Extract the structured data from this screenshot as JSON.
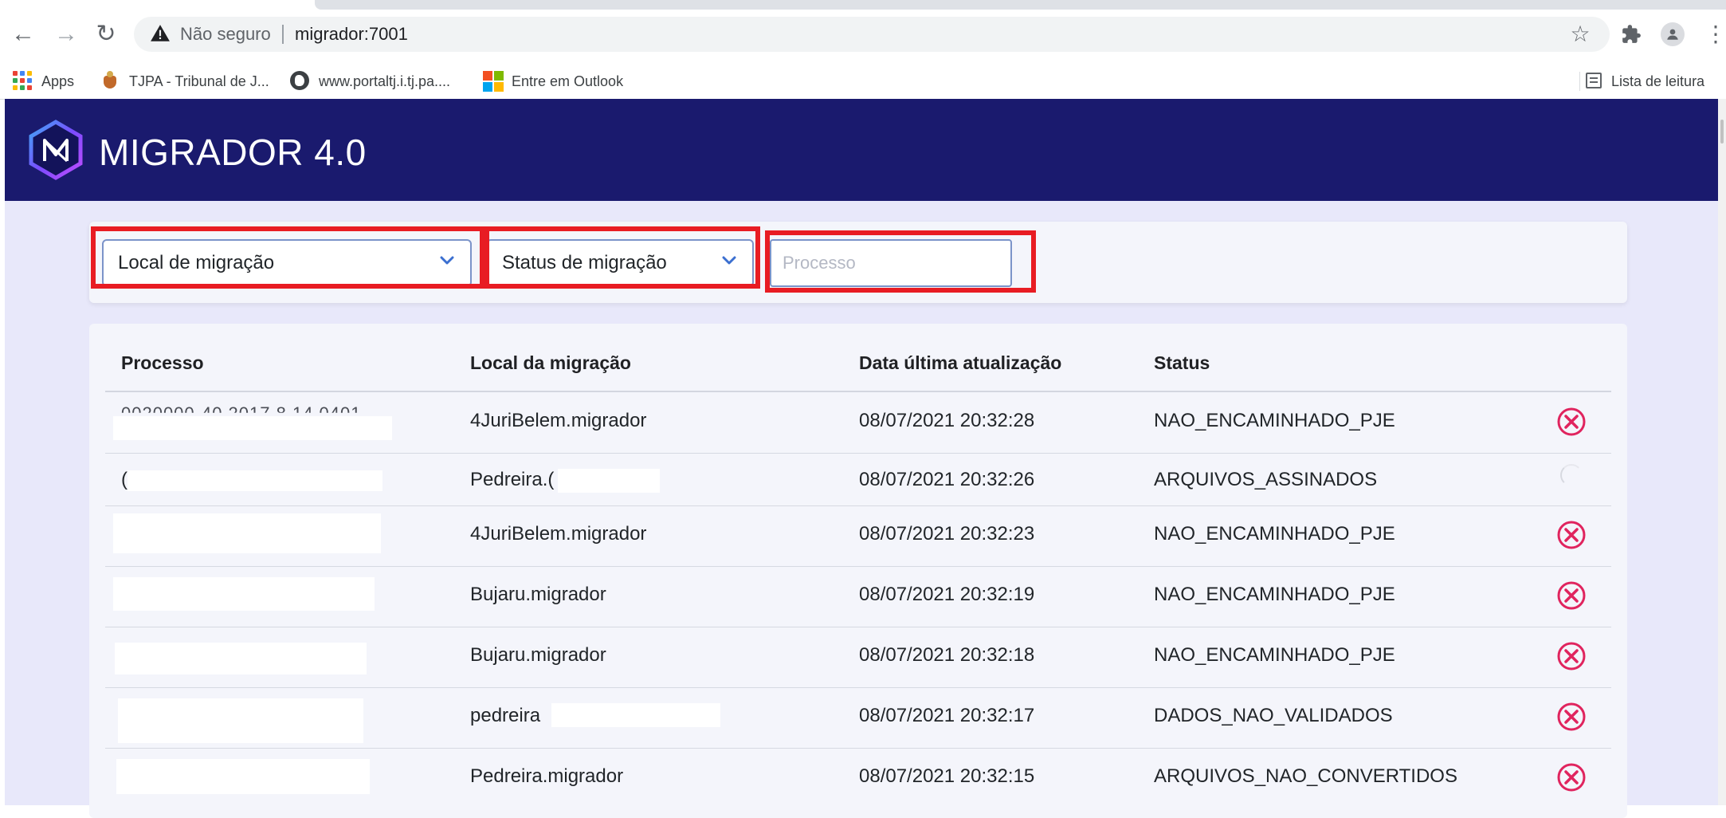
{
  "browser": {
    "insecure_label": "Não seguro",
    "url": "migrador:7001",
    "bookmarks": {
      "apps": "Apps",
      "tjpa": "TJPA - Tribunal de J...",
      "portal": "www.portaltj.i.tj.pa....",
      "outlook": "Entre em Outlook",
      "reading_list": "Lista de leitura"
    }
  },
  "app": {
    "title": "MIGRADOR 4.0",
    "colors": {
      "header": "#1a1a6e",
      "background": "#e8e8fa",
      "cancel": "#e0245e",
      "highlight": "#e81c23"
    }
  },
  "filters": {
    "local_placeholder": "Local de migração",
    "status_placeholder": "Status de migração",
    "processo_placeholder": "Processo"
  },
  "table": {
    "headers": {
      "processo": "Processo",
      "local": "Local da migração",
      "data": "Data última atualização",
      "status": "Status"
    },
    "rows": [
      {
        "processo": "0020000-40.2017.8.14.0401",
        "local": "4JuriBelem.migrador",
        "data": "08/07/2021 20:32:28",
        "status": "NAO_ENCAMINHADO_PJE",
        "action": "cancel-icon"
      },
      {
        "processo": "(",
        "local": "Pedreira.(",
        "data": "08/07/2021 20:32:26",
        "status": "ARQUIVOS_ASSINADOS",
        "action": "spinner-icon"
      },
      {
        "processo": "",
        "local": "4JuriBelem.migrador",
        "data": "08/07/2021 20:32:23",
        "status": "NAO_ENCAMINHADO_PJE",
        "action": "cancel-icon"
      },
      {
        "processo": "",
        "local": "Bujaru.migrador",
        "data": "08/07/2021 20:32:19",
        "status": "NAO_ENCAMINHADO_PJE",
        "action": "cancel-icon"
      },
      {
        "processo": "",
        "local": "Bujaru.migrador",
        "data": "08/07/2021 20:32:18",
        "status": "NAO_ENCAMINHADO_PJE",
        "action": "cancel-icon"
      },
      {
        "processo": "",
        "local": "pedreira",
        "data": "08/07/2021 20:32:17",
        "status": "DADOS_NAO_VALIDADOS",
        "action": "cancel-icon"
      },
      {
        "processo": "",
        "local": "Pedreira.migrador",
        "data": "08/07/2021 20:32:15",
        "status": "ARQUIVOS_NAO_CONVERTIDOS",
        "action": "cancel-icon"
      }
    ]
  }
}
